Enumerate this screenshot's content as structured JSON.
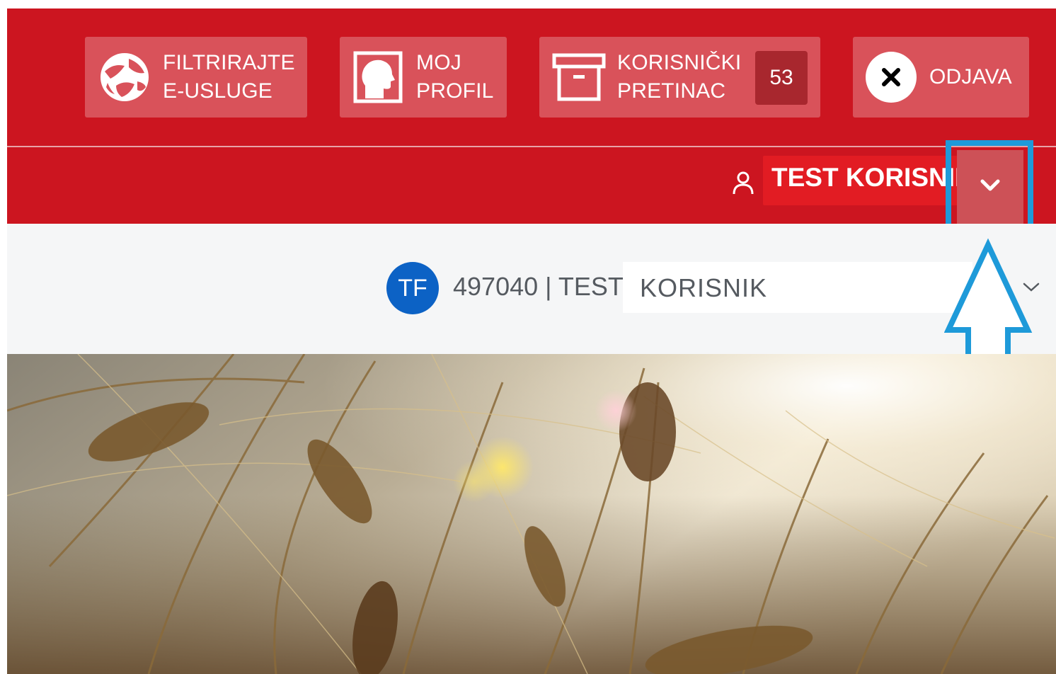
{
  "toolbar": {
    "filter": {
      "line1": "FILTRIRAJTE",
      "line2": "E-USLUGE"
    },
    "profile": {
      "line1": "MOJ",
      "line2": "PROFIL"
    },
    "inbox": {
      "line1": "KORISNIČKI",
      "line2": "PRETINAC",
      "badge": "53"
    },
    "logout": {
      "label": "ODJAVA"
    }
  },
  "user_bar": {
    "name": "TEST KORISNIK"
  },
  "account": {
    "avatar_initials": "TF",
    "id_text": "497040 | TEST",
    "selected": "KORISNIK"
  },
  "colors": {
    "brand_red": "#cc1520",
    "button_bg": "#d9525a",
    "highlight_blue": "#1e9ad9",
    "avatar_blue": "#0c62c5"
  },
  "icons": {
    "filter": "globe-icon",
    "profile": "head-profile-icon",
    "inbox": "archive-box-icon",
    "logout": "close-icon",
    "user": "person-icon",
    "dropdown": "chevron-down-icon"
  }
}
